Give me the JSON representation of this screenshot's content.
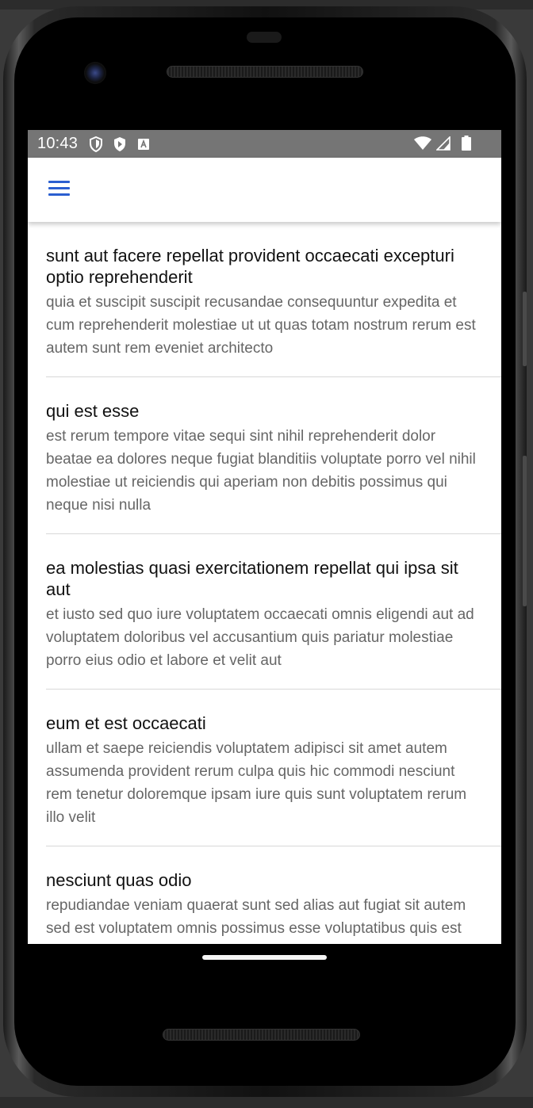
{
  "status_bar": {
    "time": "10:43",
    "left_icons": [
      "shield-icon",
      "play-protect-icon",
      "text-a-icon"
    ],
    "right_icons": [
      "wifi-icon",
      "cellular-signal-icon",
      "battery-icon"
    ]
  },
  "app_bar": {
    "menu_icon": "hamburger-menu-icon",
    "accent_color": "#2b5fd0"
  },
  "posts": [
    {
      "title": "sunt aut facere repellat provident occaecati excepturi optio reprehenderit",
      "body": "quia et suscipit suscipit recusandae consequuntur expedita et cum reprehenderit molestiae ut ut quas totam nostrum rerum est autem sunt rem eveniet architecto"
    },
    {
      "title": "qui est esse",
      "body": "est rerum tempore vitae sequi sint nihil reprehenderit dolor beatae ea dolores neque fugiat blanditiis voluptate porro vel nihil molestiae ut reiciendis qui aperiam non debitis possimus qui neque nisi nulla"
    },
    {
      "title": "ea molestias quasi exercitationem repellat qui ipsa sit aut",
      "body": "et iusto sed quo iure voluptatem occaecati omnis eligendi aut ad voluptatem doloribus vel accusantium quis pariatur molestiae porro eius odio et labore et velit aut"
    },
    {
      "title": "eum et est occaecati",
      "body": "ullam et saepe reiciendis voluptatem adipisci sit amet autem assumenda provident rerum culpa quis hic commodi nesciunt rem tenetur doloremque ipsam iure quis sunt voluptatem rerum illo velit"
    },
    {
      "title": "nesciunt quas odio",
      "body": "repudiandae veniam quaerat sunt sed alias aut fugiat sit autem sed est voluptatem omnis possimus esse voluptatibus quis est aut tenetur dolor neque"
    }
  ]
}
